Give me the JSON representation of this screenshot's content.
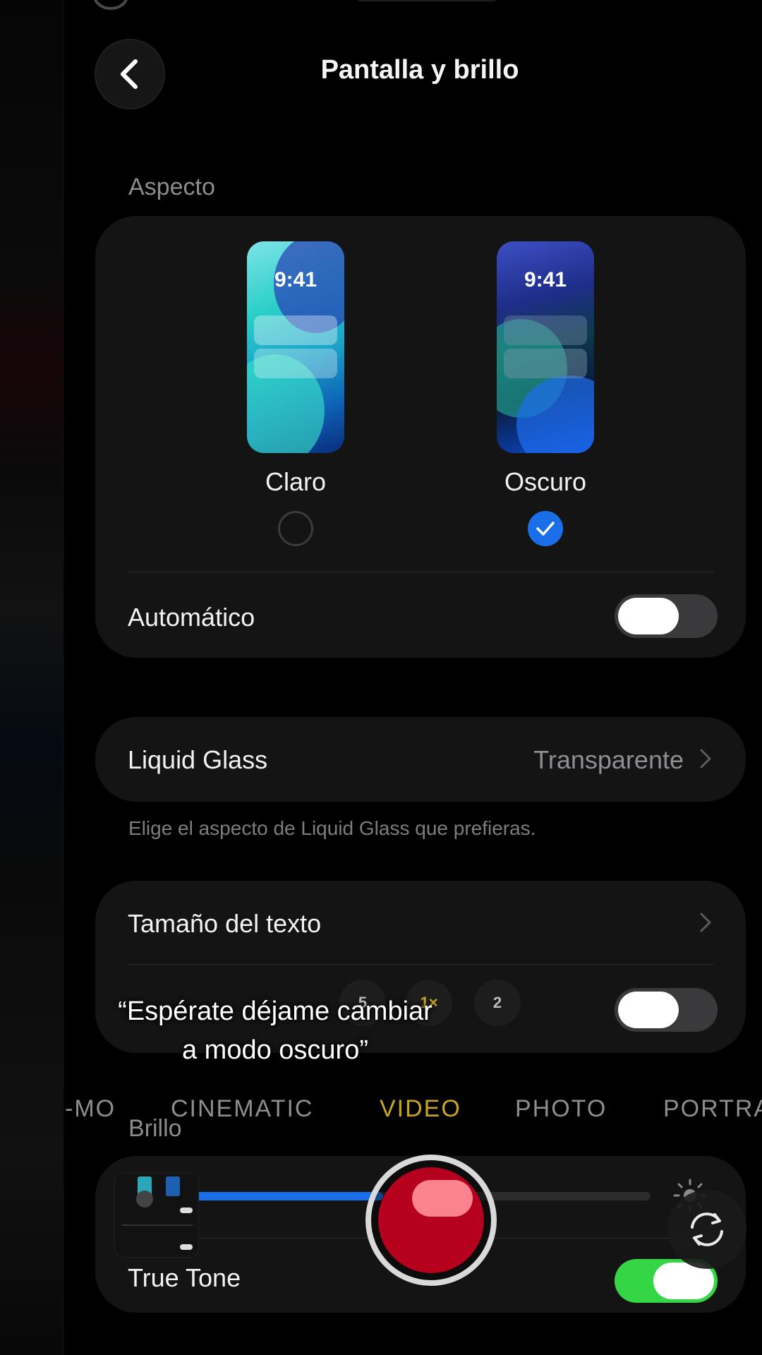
{
  "header": {
    "title": "Pantalla y brillo",
    "back_icon": "chevron-left-icon"
  },
  "appearance": {
    "section_label": "Aspecto",
    "options": [
      {
        "label": "Claro",
        "preview_time": "9:41",
        "selected": false
      },
      {
        "label": "Oscuro",
        "preview_time": "9:41",
        "selected": true
      }
    ],
    "automatic_label": "Automático",
    "automatic_on": false
  },
  "liquid_glass": {
    "label": "Liquid Glass",
    "value": "Transparente",
    "footnote": "Elige el aspecto de Liquid Glass que prefieras."
  },
  "text": {
    "text_size_label": "Tamaño del texto",
    "bold_toggle_on": false
  },
  "camera": {
    "zoom_levels": [
      "5",
      "1×",
      "2"
    ],
    "modes": [
      "-MO",
      "CINEMATIC",
      "VIDEO",
      "PHOTO",
      "PORTRA"
    ],
    "active_mode": "VIDEO"
  },
  "caption": {
    "line1": "“Espérate déjame cambiar",
    "line2": "a modo oscuro”"
  },
  "brightness": {
    "section_label": "Brillo",
    "level": 0.42,
    "true_tone_label": "True Tone",
    "true_tone_on": true
  },
  "colors": {
    "accent_blue": "#1a6fe8",
    "toggle_green": "#34d645",
    "record_red": "#b5001e",
    "mode_active": "#c8a426"
  }
}
